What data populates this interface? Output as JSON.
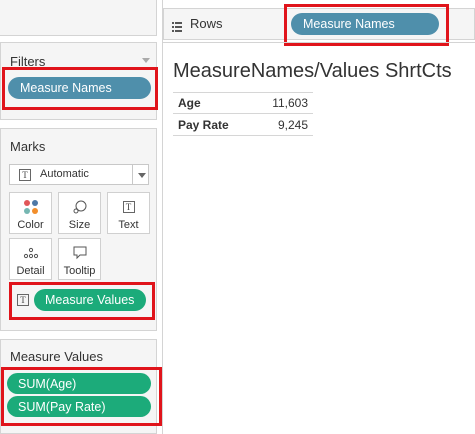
{
  "shelves": {
    "rows_label": "Rows",
    "rows_pill": "Measure Names"
  },
  "filters": {
    "title": "Filters",
    "pill": "Measure Names"
  },
  "marks": {
    "title": "Marks",
    "mark_type": "Automatic",
    "buttons": {
      "color": "Color",
      "size": "Size",
      "text": "Text",
      "detail": "Detail",
      "tooltip": "Tooltip"
    },
    "text_pill": "Measure Values"
  },
  "measure_values": {
    "title": "Measure Values",
    "items": [
      "SUM(Age)",
      "SUM(Pay Rate)"
    ]
  },
  "view": {
    "title": "MeasureNames/Values ShrtCts",
    "rows": [
      {
        "label": "Age",
        "value": "11,603"
      },
      {
        "label": "Pay Rate",
        "value": "9,245"
      }
    ]
  },
  "colors": {
    "pill_blue": "#4f8fab",
    "pill_green": "#1cab7a",
    "highlight_red": "#e0141b"
  }
}
